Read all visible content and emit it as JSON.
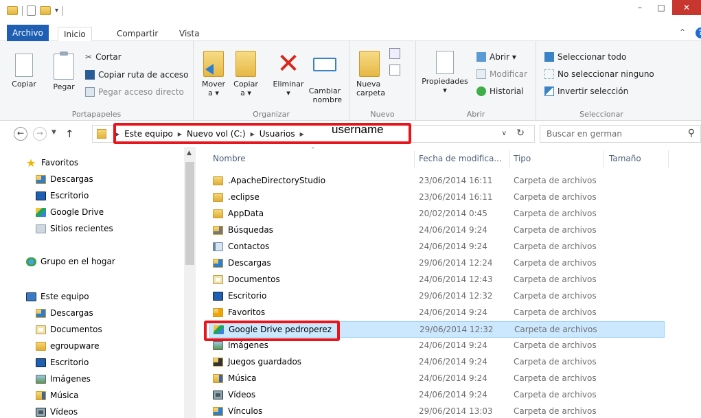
{
  "window": {
    "title": "",
    "controls": {
      "minimize": "–",
      "maximize": "□",
      "close": "✕"
    }
  },
  "ribbon": {
    "tabs": [
      "Archivo",
      "Inicio",
      "Compartir",
      "Vista"
    ],
    "groups": {
      "portapapeles": {
        "label": "Portapapeles",
        "copiar": "Copiar",
        "pegar": "Pegar",
        "cortar": "Cortar",
        "copiar_ruta": "Copiar ruta de acceso",
        "pegar_acceso": "Pegar acceso directo"
      },
      "organizar": {
        "label": "Organizar",
        "mover_1": "Mover",
        "mover_2": "a ▾",
        "copiar_1": "Copiar",
        "copiar_2": "a ▾",
        "eliminar_1": "Eliminar",
        "eliminar_2": "▾",
        "cambiar_1": "Cambiar",
        "cambiar_2": "nombre"
      },
      "nuevo": {
        "label": "Nuevo",
        "nueva_1": "Nueva",
        "nueva_2": "carpeta"
      },
      "abrir": {
        "label": "Abrir",
        "propiedades": "Propiedades",
        "prop_dd": "▾",
        "abrir": "Abrir ▾",
        "modificar": "Modificar",
        "historial": "Historial"
      },
      "seleccionar": {
        "label": "Seleccionar",
        "todo": "Seleccionar todo",
        "ninguno": "No seleccionar ninguno",
        "invertir": "Invertir selección"
      }
    }
  },
  "address": {
    "crumbs": [
      "Este equipo",
      "Nuevo vol (C:)",
      "Usuarios"
    ],
    "username": "username",
    "search_placeholder": "Buscar en german"
  },
  "navpane": {
    "favoritos": "Favoritos",
    "fav_items": [
      "Descargas",
      "Escritorio",
      "Google Drive",
      "Sitios recientes"
    ],
    "grupo": "Grupo en el hogar",
    "equipo": "Este equipo",
    "equipo_items": [
      "Descargas",
      "Documentos",
      "egroupware",
      "Escritorio",
      "Imágenes",
      "Música",
      "Vídeos"
    ]
  },
  "columns": {
    "nombre": "Nombre",
    "fecha": "Fecha de modifica...",
    "tipo": "Tipo",
    "tamano": "Tamaño"
  },
  "files": [
    {
      "name": ".ApacheDirectoryStudio",
      "date": "23/06/2014 16:11",
      "type": "Carpeta de archivos",
      "icon": "folder"
    },
    {
      "name": ".eclipse",
      "date": "23/06/2014 16:11",
      "type": "Carpeta de archivos",
      "icon": "folder"
    },
    {
      "name": "AppData",
      "date": "20/02/2014 0:45",
      "type": "Carpeta de archivos",
      "icon": "folder"
    },
    {
      "name": "Búsquedas",
      "date": "24/06/2014 9:24",
      "type": "Carpeta de archivos",
      "icon": "search"
    },
    {
      "name": "Contactos",
      "date": "24/06/2014 9:24",
      "type": "Carpeta de archivos",
      "icon": "contacts"
    },
    {
      "name": "Descargas",
      "date": "29/06/2014 12:24",
      "type": "Carpeta de archivos",
      "icon": "dl"
    },
    {
      "name": "Documentos",
      "date": "24/06/2014 12:43",
      "type": "Carpeta de archivos",
      "icon": "docs"
    },
    {
      "name": "Escritorio",
      "date": "29/06/2014 12:32",
      "type": "Carpeta de archivos",
      "icon": "desk"
    },
    {
      "name": "Favoritos",
      "date": "24/06/2014 9:24",
      "type": "Carpeta de archivos",
      "icon": "fav"
    },
    {
      "name": "Google Drive pedroperez",
      "date": "29/06/2014 12:32",
      "type": "Carpeta de archivos",
      "icon": "gdrive",
      "selected": true
    },
    {
      "name": "Imágenes",
      "date": "24/06/2014 9:24",
      "type": "Carpeta de archivos",
      "icon": "pics"
    },
    {
      "name": "Juegos guardados",
      "date": "24/06/2014 9:24",
      "type": "Carpeta de archivos",
      "icon": "games"
    },
    {
      "name": "Música",
      "date": "24/06/2014 9:24",
      "type": "Carpeta de archivos",
      "icon": "music"
    },
    {
      "name": "Vídeos",
      "date": "24/06/2014 9:24",
      "type": "Carpeta de archivos",
      "icon": "video"
    },
    {
      "name": "Vínculos",
      "date": "29/06/2014 13:03",
      "type": "Carpeta de archivos",
      "icon": "link"
    }
  ],
  "colors": {
    "accent": "#1e5fb3",
    "selection": "#cce8ff",
    "highlight_box": "#e8141c"
  }
}
